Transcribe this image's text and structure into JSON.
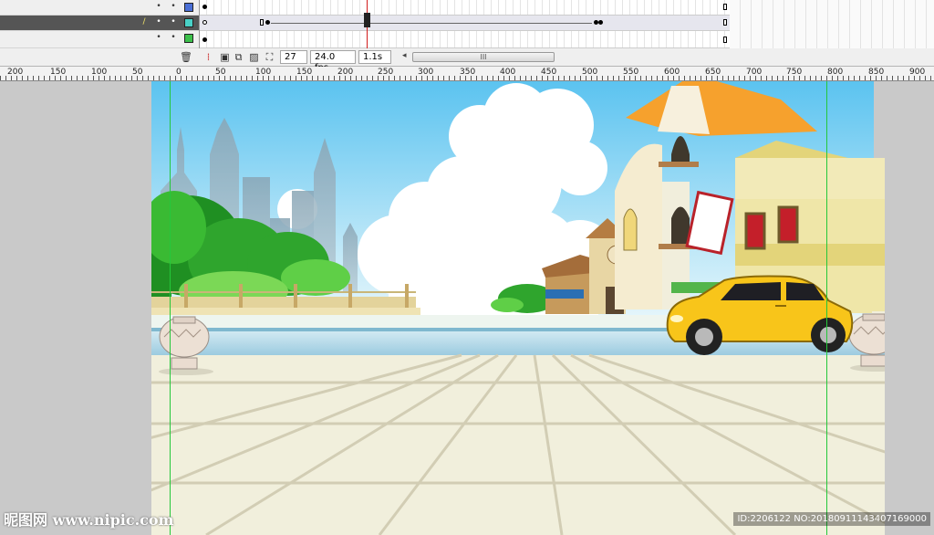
{
  "timeline": {
    "layers": [
      {
        "color": "#4a6fd6",
        "selected": false
      },
      {
        "color": "#49d1c7",
        "selected": true
      },
      {
        "color": "#3cc04b",
        "selected": false
      }
    ],
    "pencil_icon": "pencil-icon",
    "eye_icon": "dot-icon",
    "lock_icon": "dot-icon"
  },
  "statusbar": {
    "trash_icon": "trash-icon",
    "onion_icons": [
      "center-frame-icon",
      "onion-skin-icon",
      "onion-outline-icon",
      "edit-multiple-icon",
      "modify-markers-icon"
    ],
    "current_frame": "27",
    "frame_rate": "24.0 fps",
    "elapsed_time": "1.1s",
    "scroll_grip": "III"
  },
  "ruler": {
    "labels": [
      "200",
      "150",
      "100",
      "50",
      "0",
      "50",
      "100",
      "150",
      "200",
      "250",
      "300",
      "350",
      "400",
      "450",
      "500",
      "550",
      "600",
      "650",
      "700",
      "750",
      "800",
      "850",
      "900"
    ]
  },
  "watermark": {
    "left": "昵图网 www.nipic.com",
    "right": "ID:2206122 NO:20180911143407169000"
  },
  "colors": {
    "sky_top": "#5bc3f0",
    "sky_bottom": "#d9f1fb",
    "car": "#f8c51a",
    "roof": "#f2992c",
    "tree": "#2fa52d",
    "ground": "#f1efdc"
  }
}
